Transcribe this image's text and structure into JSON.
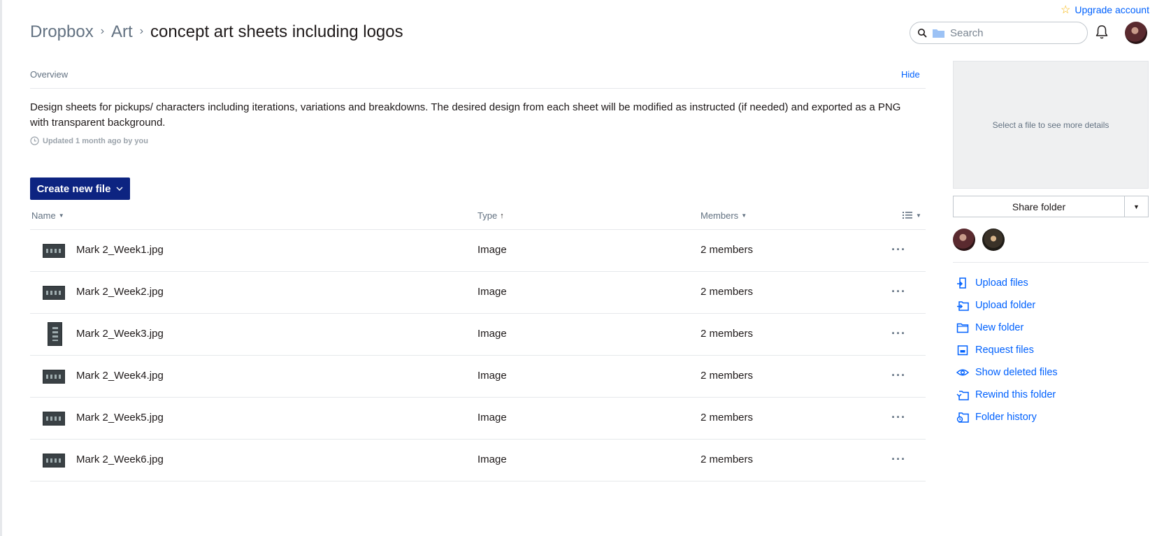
{
  "header": {
    "breadcrumb": [
      "Dropbox",
      "Art",
      "concept art sheets including logos"
    ],
    "upgrade_label": "Upgrade account",
    "search_placeholder": "Search"
  },
  "overview": {
    "label": "Overview",
    "hide_label": "Hide",
    "description": "Design sheets for pickups/ characters including iterations, variations and breakdowns. The desired design from each sheet will be modified as instructed (if needed) and exported as a PNG with transparent background.",
    "updated": "Updated 1 month ago by you"
  },
  "create_button": "Create new file",
  "table": {
    "columns": {
      "name": "Name",
      "type": "Type",
      "members": "Members"
    },
    "sort": {
      "column": "type",
      "direction": "ascending"
    },
    "rows": [
      {
        "name": "Mark 2_Week1.jpg",
        "type": "Image",
        "members": "2 members"
      },
      {
        "name": "Mark 2_Week2.jpg",
        "type": "Image",
        "members": "2 members"
      },
      {
        "name": "Mark 2_Week3.jpg",
        "type": "Image",
        "members": "2 members"
      },
      {
        "name": "Mark 2_Week4.jpg",
        "type": "Image",
        "members": "2 members"
      },
      {
        "name": "Mark 2_Week5.jpg",
        "type": "Image",
        "members": "2 members"
      },
      {
        "name": "Mark 2_Week6.jpg",
        "type": "Image",
        "members": "2 members"
      }
    ]
  },
  "sidebar": {
    "details_placeholder": "Select a file to see more details",
    "share_label": "Share folder",
    "actions": [
      {
        "label": "Upload files",
        "icon": "upload-files-icon"
      },
      {
        "label": "Upload folder",
        "icon": "upload-folder-icon"
      },
      {
        "label": "New folder",
        "icon": "new-folder-icon"
      },
      {
        "label": "Request files",
        "icon": "request-files-icon"
      },
      {
        "label": "Show deleted files",
        "icon": "eye-icon"
      },
      {
        "label": "Rewind this folder",
        "icon": "rewind-icon"
      },
      {
        "label": "Folder history",
        "icon": "folder-history-icon"
      }
    ]
  },
  "colors": {
    "accent": "#0061fe",
    "create_button_bg": "#0d2481",
    "muted_text": "#637282"
  }
}
